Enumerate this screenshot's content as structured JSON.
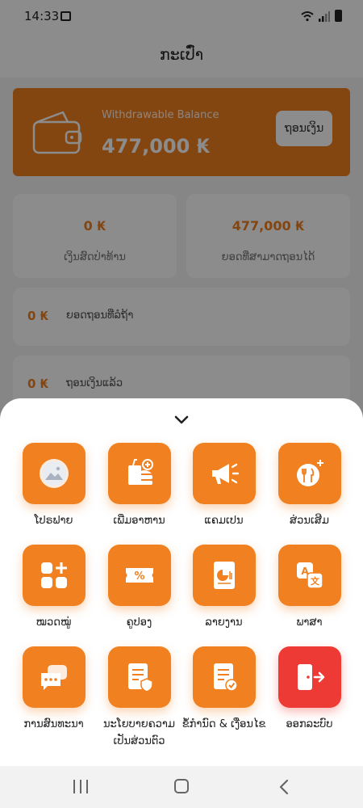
{
  "status": {
    "time": "14:33"
  },
  "header": {
    "title": "ກະເປົ໋າ"
  },
  "balance": {
    "label": "Withdrawable Balance",
    "amount": "477,000 ₭",
    "withdraw_label": "ຖອນເງິນ"
  },
  "stats": [
    {
      "value": "0 ₭",
      "label": "ເງິນສົດປ່າທ້ານ"
    },
    {
      "value": "477,000 ₭",
      "label": "ຍອດທີ່ສາມາດຖອນໄດ້"
    }
  ],
  "rows": [
    {
      "value": "0 ₭",
      "label": "ຍອດຖອນທີ່ລໍຖ້າ"
    },
    {
      "value": "0 ₭",
      "label": "ຖອນເງິນແລ້ວ"
    }
  ],
  "sheet": {
    "items": [
      {
        "label": "ໂປຣຟາຍ",
        "icon": "profile-image-icon"
      },
      {
        "label": "ເພີ່ມອາຫານ",
        "icon": "add-food-icon"
      },
      {
        "label": "ແຄມເປນ",
        "icon": "megaphone-icon"
      },
      {
        "label": "ສ່ວນເສີມ",
        "icon": "add-on-icon"
      },
      {
        "label": "ໝວດໝູ່",
        "icon": "category-icon"
      },
      {
        "label": "ຄູປອງ",
        "icon": "coupon-icon"
      },
      {
        "label": "ລາຍງານ",
        "icon": "report-icon"
      },
      {
        "label": "ພາສາ",
        "icon": "language-icon"
      },
      {
        "label": "ການສົນທະນາ",
        "icon": "chat-icon"
      },
      {
        "label": "ນະໂຍບາຍຄວາມເປັນສ່ວນຕົວ",
        "icon": "privacy-policy-icon"
      },
      {
        "label": "ຂໍ້ກຳນົດ & ເງື່ອນໄຂ",
        "icon": "terms-icon"
      },
      {
        "label": "ອອກລະບົບ",
        "icon": "logout-icon"
      }
    ]
  },
  "colors": {
    "accent": "#f08020",
    "danger": "#ee3a35"
  }
}
